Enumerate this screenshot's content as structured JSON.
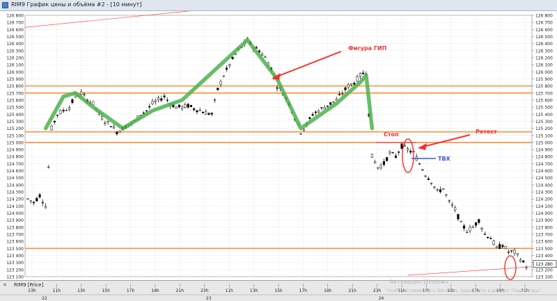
{
  "window": {
    "title": "RIM9 График цены и объёма #2 - [10 минут]"
  },
  "bottom": {
    "series_label": "RIM9 [Price]"
  },
  "watermark": {
    "line1": "Активация Windows",
    "line2": "Чтобы активировать Windows, перейдите в раздел \"Параметры\"."
  },
  "chart_data": {
    "type": "candlestick",
    "title": "",
    "ylim": [
      123100,
      126800
    ],
    "y_ticks": [
      126800,
      126700,
      126600,
      126500,
      126400,
      126300,
      126200,
      126100,
      126000,
      125900,
      125800,
      125700,
      125600,
      125500,
      125400,
      125300,
      125200,
      125100,
      125000,
      124900,
      124800,
      124700,
      124600,
      124500,
      124400,
      124300,
      124200,
      124100,
      124000,
      123900,
      123800,
      123700,
      123600,
      123500,
      123400,
      123300,
      123200,
      123100
    ],
    "tick_labels": [
      "126 800",
      "126 700",
      "126 600",
      "126 500",
      "126 400",
      "126 300",
      "126 200",
      "126 100",
      "126 000",
      "125 900",
      "125 800",
      "125 700",
      "125 600",
      "125 500",
      "125 400",
      "125 300",
      "125 200",
      "125 100",
      "125 000",
      "124 900",
      "124 800",
      "124 700",
      "124 600",
      "124 500",
      "124 400",
      "124 300",
      "124 200",
      "124 100",
      "124 000",
      "123 900",
      "123 800",
      "123 700",
      "123 600",
      "123 500",
      "123 400",
      "123 300",
      "123 200",
      "123 100"
    ],
    "x_labels": [
      "23h",
      "11h",
      "13h",
      "15h",
      "17h",
      "19h",
      "21h",
      "23h",
      "11h",
      "13h",
      "15h",
      "17h",
      "19h",
      "21h",
      "23h",
      "11h",
      "13h",
      "15h",
      "17h",
      "19h",
      "21h"
    ],
    "date_labels": [
      "22",
      "23",
      "24"
    ],
    "current_price_label": "123 280",
    "horizontal_levels": [
      125800,
      125700,
      125150,
      125000,
      123500
    ],
    "annotations": {
      "pattern": "Фигура ГИП",
      "stop": "Стоп",
      "retest": "Ретест",
      "entry": "ТВХ"
    },
    "colors": {
      "levels": "#ff8c3a",
      "pattern_line": "#4cb34c",
      "annotation": "#ff2b2b",
      "entry": "#3c55d8",
      "candles": "#000000",
      "grid": "#d8d8d8"
    },
    "price_path": [
      [
        0,
        124200
      ],
      [
        2,
        124150
      ],
      [
        4,
        124250
      ],
      [
        6,
        124100
      ],
      [
        8,
        125200
      ],
      [
        10,
        125400
      ],
      [
        12,
        125450
      ],
      [
        14,
        125500
      ],
      [
        16,
        125650
      ],
      [
        18,
        125700
      ],
      [
        20,
        125600
      ],
      [
        22,
        125550
      ],
      [
        24,
        125400
      ],
      [
        26,
        125300
      ],
      [
        28,
        125250
      ],
      [
        30,
        125150
      ],
      [
        32,
        125200
      ],
      [
        34,
        125250
      ],
      [
        36,
        125300
      ],
      [
        38,
        125400
      ],
      [
        40,
        125450
      ],
      [
        42,
        125550
      ],
      [
        44,
        125600
      ],
      [
        46,
        125650
      ],
      [
        48,
        125550
      ],
      [
        50,
        125500
      ],
      [
        52,
        125500
      ],
      [
        54,
        125520
      ],
      [
        56,
        125480
      ],
      [
        58,
        125450
      ],
      [
        60,
        125420
      ],
      [
        62,
        125400
      ],
      [
        64,
        125750
      ],
      [
        66,
        125950
      ],
      [
        68,
        126100
      ],
      [
        70,
        126250
      ],
      [
        72,
        126350
      ],
      [
        74,
        126450
      ],
      [
        76,
        126350
      ],
      [
        78,
        126300
      ],
      [
        80,
        126200
      ],
      [
        82,
        126050
      ],
      [
        84,
        125800
      ],
      [
        86,
        125700
      ],
      [
        88,
        125550
      ],
      [
        90,
        125350
      ],
      [
        92,
        125150
      ],
      [
        94,
        125250
      ],
      [
        96,
        125400
      ],
      [
        98,
        125450
      ],
      [
        100,
        125500
      ],
      [
        102,
        125550
      ],
      [
        104,
        125600
      ],
      [
        106,
        125700
      ],
      [
        108,
        125800
      ],
      [
        110,
        125850
      ],
      [
        112,
        125950
      ],
      [
        114,
        126000
      ],
      [
        116,
        124800
      ],
      [
        118,
        124650
      ],
      [
        120,
        124700
      ],
      [
        122,
        124850
      ],
      [
        124,
        124800
      ],
      [
        126,
        124950
      ],
      [
        128,
        124900
      ],
      [
        130,
        124850
      ],
      [
        132,
        124700
      ],
      [
        134,
        124550
      ],
      [
        136,
        124450
      ],
      [
        138,
        124300
      ],
      [
        140,
        124350
      ],
      [
        142,
        124150
      ],
      [
        144,
        124050
      ],
      [
        146,
        123850
      ],
      [
        148,
        123750
      ],
      [
        150,
        123800
      ],
      [
        152,
        123900
      ],
      [
        154,
        123700
      ],
      [
        156,
        123650
      ],
      [
        158,
        123500
      ],
      [
        160,
        123550
      ],
      [
        162,
        123450
      ],
      [
        164,
        123450
      ],
      [
        166,
        123350
      ],
      [
        168,
        123250
      ]
    ]
  }
}
